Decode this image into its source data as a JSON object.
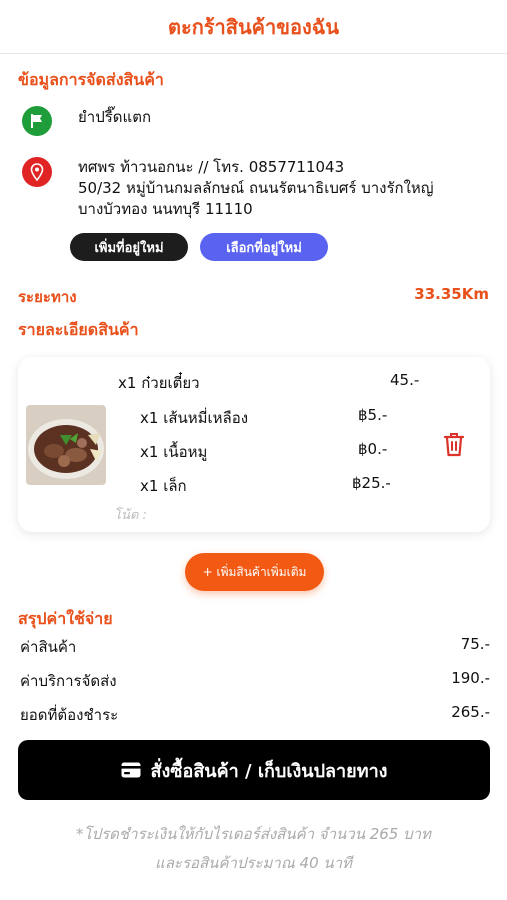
{
  "header": {
    "title": "ตะกร้าสินค้าของฉัน"
  },
  "shipping": {
    "section_title": "ข้อมูลการจัดส่งสินค้า",
    "shop_name": "ยำปรี๊ดแตก",
    "recipient_line1": "ทศพร ท้าวนอกนะ // โทร. 0857711043",
    "recipient_line2": "50/32 หมู่บ้านกมลลักษณ์ ถนนรัตนาธิเบศร์ บางรักใหญ่",
    "recipient_line3": "บางบัวทอง นนทบุรี 11110",
    "add_address_label": "เพิ่มที่อยู่ใหม่",
    "choose_address_label": "เลือกที่อยู่ใหม่",
    "shop_icon": "flag-icon",
    "address_icon": "location-pin-icon"
  },
  "distance": {
    "label": "ระยะทาง",
    "value": "33.35Km"
  },
  "items": {
    "section_title": "รายละเอียดสินค้า",
    "main_item": "x1 ก๋วยเตี๋ยว",
    "main_price": "45.-",
    "options": [
      {
        "label": "x1 เส้นหมี่เหลือง",
        "price": "฿5.-"
      },
      {
        "label": "x1 เนื้อหมู",
        "price": "฿0.-"
      },
      {
        "label": "x1 เล็ก",
        "price": "฿25.-"
      }
    ],
    "note_placeholder": "โน้ต :",
    "delete_icon": "trash-icon"
  },
  "add_more_label": "+ เพิ่มสินค้าเพิ่มเติม",
  "summary": {
    "section_title": "สรุปค่าใช้จ่าย",
    "rows": [
      {
        "label": "ค่าสินค้า",
        "value": "75.-"
      },
      {
        "label": "ค่าบริการจัดส่ง",
        "value": "190.-"
      },
      {
        "label": "ยอดที่ต้องชำระ",
        "value": "265.-"
      }
    ]
  },
  "checkout": {
    "label": "สั่งซื้อสินค้า / เก็บเงินปลายทาง",
    "icon": "wallet-icon"
  },
  "footer": {
    "line1": "*โปรดชำระเงินให้กับไรเดอร์ส่งสินค้า จำนวน 265 บาท",
    "line2": "และรอสินค้าประมาณ 40 นาที"
  },
  "colors": {
    "accent": "#e8501c",
    "button_orange": "#f25a14",
    "blue": "#5a63f0",
    "dark": "#1d1d1d",
    "green": "#1f9d3a",
    "red": "#e02323"
  }
}
